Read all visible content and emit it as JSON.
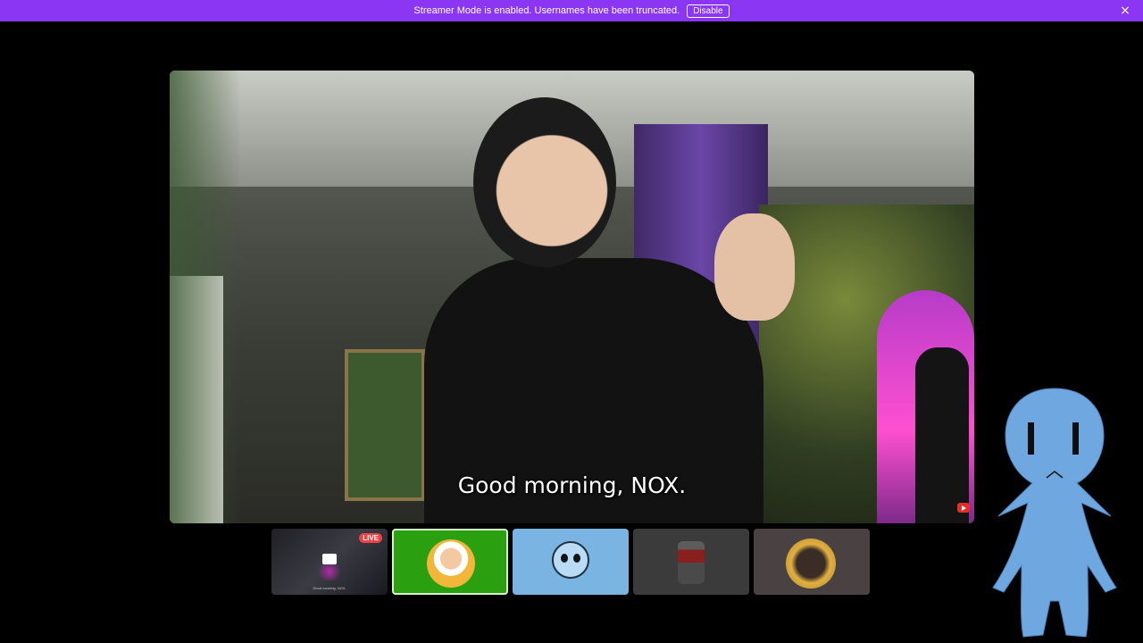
{
  "banner": {
    "message": "Streamer Mode is enabled. Usernames have been truncated.",
    "disable_label": "Disable",
    "close_icon": "×",
    "color": "#8a36f2"
  },
  "stage": {
    "subtitle": "Good morning, NOX."
  },
  "tiles": [
    {
      "type": "stream",
      "badge": "LIVE",
      "caption": "Good morning, NOX."
    },
    {
      "type": "avatar",
      "bg": "#2aa011"
    },
    {
      "type": "avatar",
      "bg": "#7ab4e2"
    },
    {
      "type": "avatar",
      "bg": "#3b3b3b"
    },
    {
      "type": "avatar",
      "bg": "#4a4242"
    }
  ],
  "colors": {
    "live_badge": "#ed4245",
    "mascot": "#6fa8e0"
  }
}
